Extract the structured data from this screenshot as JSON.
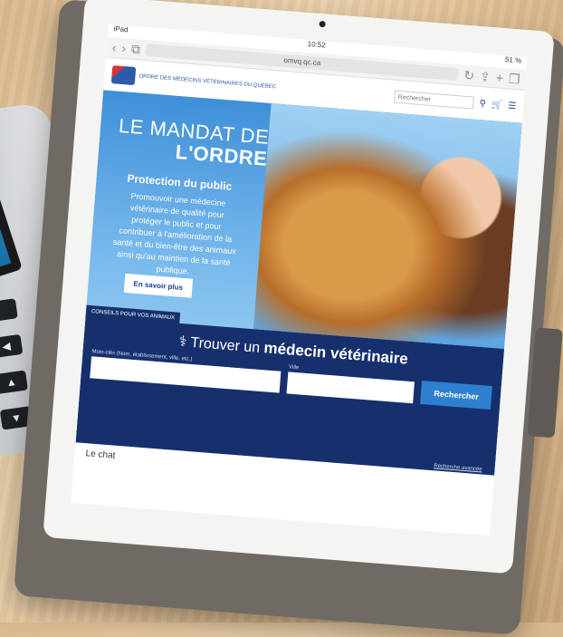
{
  "browser": {
    "carrier": "iPad",
    "time": "10:52",
    "url": "omvq.qc.ca",
    "battery": "51 %"
  },
  "site": {
    "logo_text": "ORDRE DES MÉDECINS VÉTÉRINAIRES DU QUÉBEC",
    "search_placeholder": "Rechercher"
  },
  "hero": {
    "title_line1": "LE MANDAT DE",
    "title_line2": "L'ORDRE",
    "subtitle": "Protection du public",
    "body": "Promouvoir une médecine vétérinaire de qualité pour protéger le public et pour contribuer à l'amélioration de la santé et du bien-être des animaux ainsi qu'au maintien de la santé publique.",
    "cta": "En savoir plus"
  },
  "finder": {
    "title_a": "Trouver un ",
    "title_b": "médecin vétérinaire",
    "keywords_label": "Mots-clés (Nom, établissement, ville, etc.)",
    "city_label": "Ville",
    "search_button": "Rechercher",
    "advanced_link": "Recherche avancée",
    "tab_label": "CONSEILS POUR VOS ANIMAUX"
  },
  "below": {
    "snippet": "Le chat"
  }
}
